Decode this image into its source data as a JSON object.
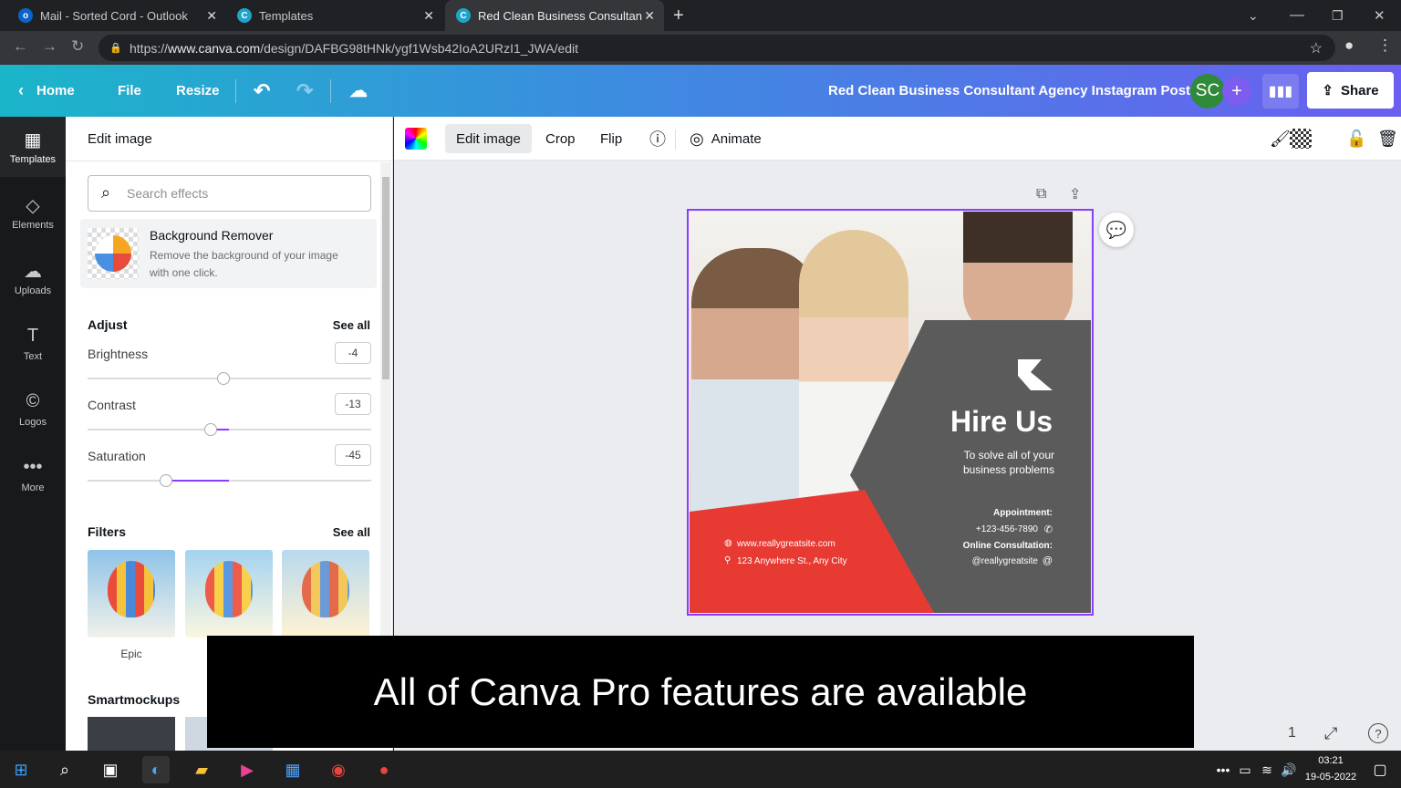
{
  "browser": {
    "tabs": [
      {
        "title": "Mail - Sorted Cord - Outlook",
        "active": false
      },
      {
        "title": "Templates",
        "active": false
      },
      {
        "title": "Red Clean Business Consultant A",
        "active": true
      }
    ],
    "new_tab": "+",
    "url_prefix": "https://",
    "url_host": "www.canva.com",
    "url_path": "/design/DAFBG98tHNk/ygf1Wsb42IoA2URzI1_JWA/edit"
  },
  "topbar": {
    "home": "Home",
    "file": "File",
    "resize": "Resize",
    "doc_title": "Red Clean Business Consultant Agency Instagram Post",
    "avatar": "SC",
    "plus": "+",
    "share": "Share"
  },
  "sidebar": {
    "items": [
      {
        "label": "Templates",
        "icon": "templates-icon"
      },
      {
        "label": "Elements",
        "icon": "elements-icon"
      },
      {
        "label": "Uploads",
        "icon": "uploads-icon"
      },
      {
        "label": "Text",
        "icon": "text-icon"
      },
      {
        "label": "Logos",
        "icon": "logos-icon"
      },
      {
        "label": "More",
        "icon": "more-icon"
      }
    ]
  },
  "panel": {
    "title": "Edit image",
    "search_placeholder": "Search effects",
    "bg_remover": {
      "title": "Background Remover",
      "desc1": "Remove the background of your image",
      "desc2": "with one click."
    },
    "adjust": {
      "heading": "Adjust",
      "see_all": "See all",
      "brightness": {
        "label": "Brightness",
        "value": "-4",
        "level": -4
      },
      "contrast": {
        "label": "Contrast",
        "value": "-13",
        "level": -13
      },
      "saturation": {
        "label": "Saturation",
        "value": "-45",
        "level": -45
      }
    },
    "filters": {
      "heading": "Filters",
      "see_all": "See all",
      "items": [
        "Epic",
        "",
        ""
      ]
    },
    "smartmockups": "Smartmockups"
  },
  "toolbar": {
    "edit_image": "Edit image",
    "crop": "Crop",
    "flip": "Flip",
    "animate": "Animate"
  },
  "design": {
    "headline": "Hire Us",
    "sub1": "To solve all of your",
    "sub2": "business problems",
    "appointment_label": "Appointment:",
    "phone": "+123-456-7890",
    "online_label": "Online Consultation:",
    "handle": "@reallygreatsite",
    "website": "www.reallygreatsite.com",
    "address": "123 Anywhere St., Any City"
  },
  "caption": "All of Canva Pro features are available",
  "footer": {
    "page": "1"
  },
  "taskbar": {
    "time": "03:21",
    "date": "19-05-2022"
  },
  "colors": {
    "accent": "#8b3dff",
    "red": "#e63a33",
    "grey": "#5b5b5b"
  }
}
